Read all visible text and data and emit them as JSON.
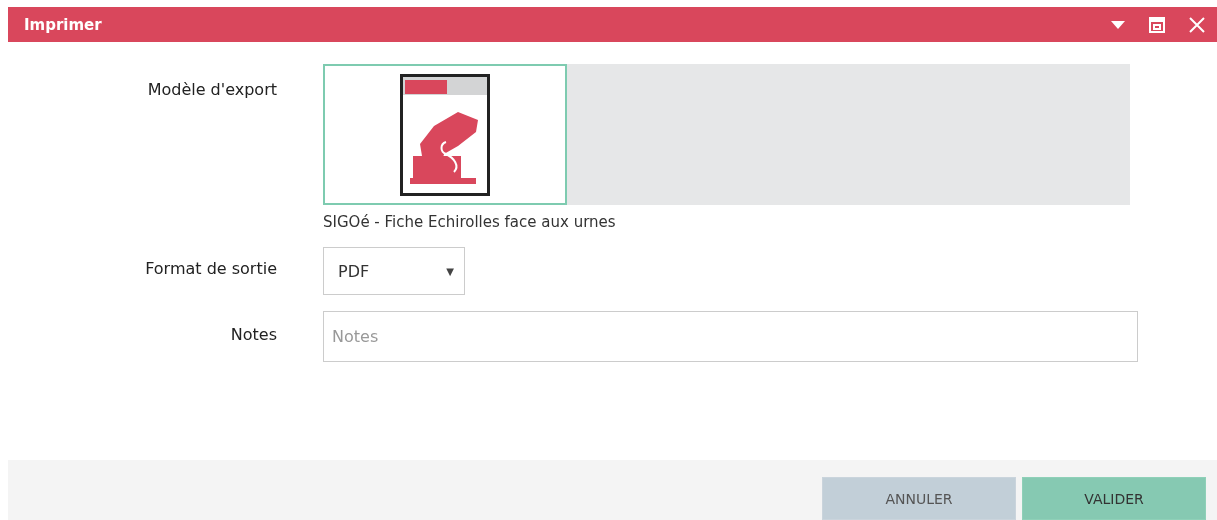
{
  "window": {
    "title": "Imprimer"
  },
  "fields": [
    {
      "kind": "gallery",
      "label": "Modèle d'export",
      "templates": [
        {
          "name": "SIGOé - Fiche Echirolles face aux urnes",
          "selected": true
        }
      ]
    },
    {
      "kind": "select",
      "label": "Format de sortie",
      "value": "PDF",
      "caret": "▼"
    },
    {
      "kind": "text",
      "label": "Notes",
      "placeholder": "Notes"
    }
  ],
  "buttons": [
    {
      "label": "ANNULER",
      "kind": "secondary"
    },
    {
      "label": "VALIDER",
      "kind": "primary"
    }
  ]
}
